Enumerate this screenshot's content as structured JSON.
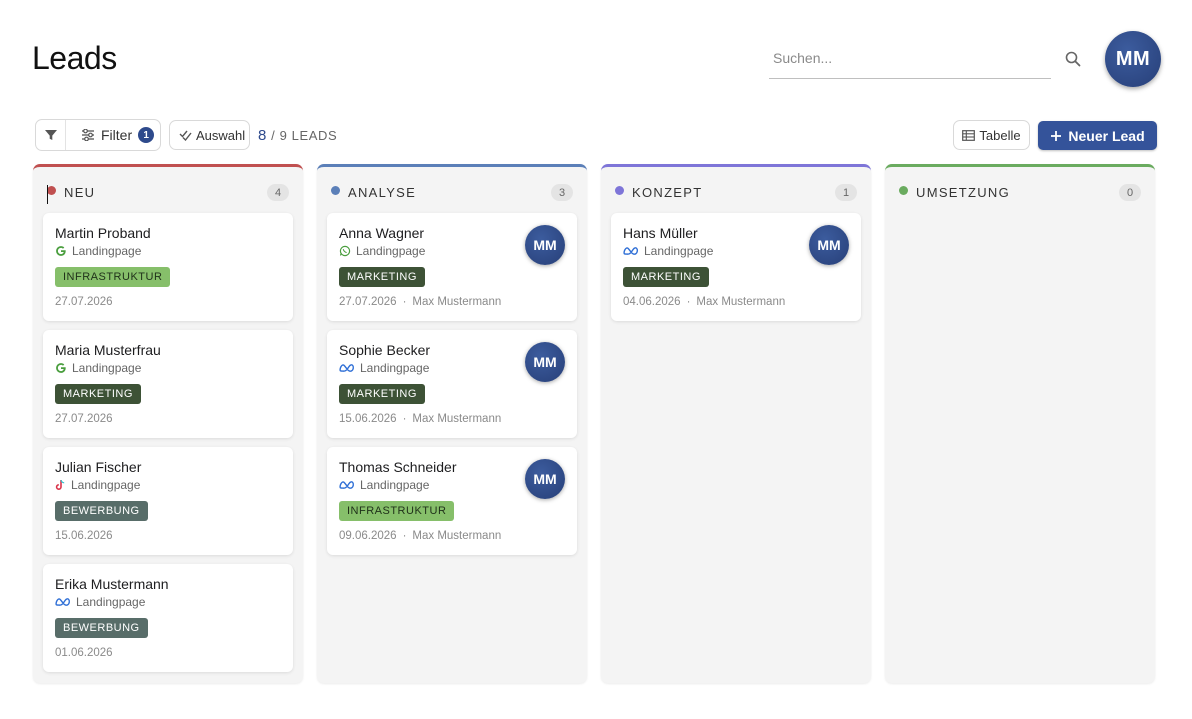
{
  "page": {
    "title": "Leads"
  },
  "search": {
    "placeholder": "Suchen..."
  },
  "user": {
    "initials": "MM"
  },
  "toolbar": {
    "filter_label": "Filter",
    "filter_count": "1",
    "select_label": "Auswahl",
    "shown_count": "8",
    "total_label": " / 9 LEADS",
    "table_label": "Tabelle",
    "new_lead_label": "Neuer Lead"
  },
  "colors": {
    "accent": "#34539a",
    "neu": "#c05050",
    "analyse": "#5b7fb8",
    "konzept": "#7e75d8",
    "umsetzung": "#6aab5f"
  },
  "columns": [
    {
      "name": "NEU",
      "count": "4",
      "cards": [
        {
          "name": "Martin Proband",
          "source_icon": "google-icon",
          "source": "Landingpage",
          "tag": "INFRASTRUKTUR",
          "date": "27.07.2026"
        },
        {
          "name": "Maria Musterfrau",
          "source_icon": "google-icon",
          "source": "Landingpage",
          "tag": "MARKETING",
          "date": "27.07.2026"
        },
        {
          "name": "Julian Fischer",
          "source_icon": "tiktok-icon",
          "source": "Landingpage",
          "tag": "BEWERBUNG",
          "date": "15.06.2026"
        },
        {
          "name": "Erika Mustermann",
          "source_icon": "meta-icon",
          "source": "Landingpage",
          "tag": "BEWERBUNG",
          "date": "01.06.2026"
        }
      ]
    },
    {
      "name": "ANALYSE",
      "count": "3",
      "cards": [
        {
          "name": "Anna Wagner",
          "source_icon": "whatsapp-icon",
          "source": "Landingpage",
          "tag": "MARKETING",
          "date": "27.07.2026",
          "owner": "Max Mustermann",
          "initials": "MM"
        },
        {
          "name": "Sophie Becker",
          "source_icon": "meta-icon",
          "source": "Landingpage",
          "tag": "MARKETING",
          "date": "15.06.2026",
          "owner": "Max Mustermann",
          "initials": "MM"
        },
        {
          "name": "Thomas Schneider",
          "source_icon": "meta-icon",
          "source": "Landingpage",
          "tag": "INFRASTRUKTUR",
          "date": "09.06.2026",
          "owner": "Max Mustermann",
          "initials": "MM"
        }
      ]
    },
    {
      "name": "KONZEPT",
      "count": "1",
      "cards": [
        {
          "name": "Hans Müller",
          "source_icon": "meta-icon",
          "source": "Landingpage",
          "tag": "MARKETING",
          "date": "04.06.2026",
          "owner": "Max Mustermann",
          "initials": "MM"
        }
      ]
    },
    {
      "name": "UMSETZUNG",
      "count": "0",
      "cards": []
    }
  ],
  "meta_separator": "·"
}
